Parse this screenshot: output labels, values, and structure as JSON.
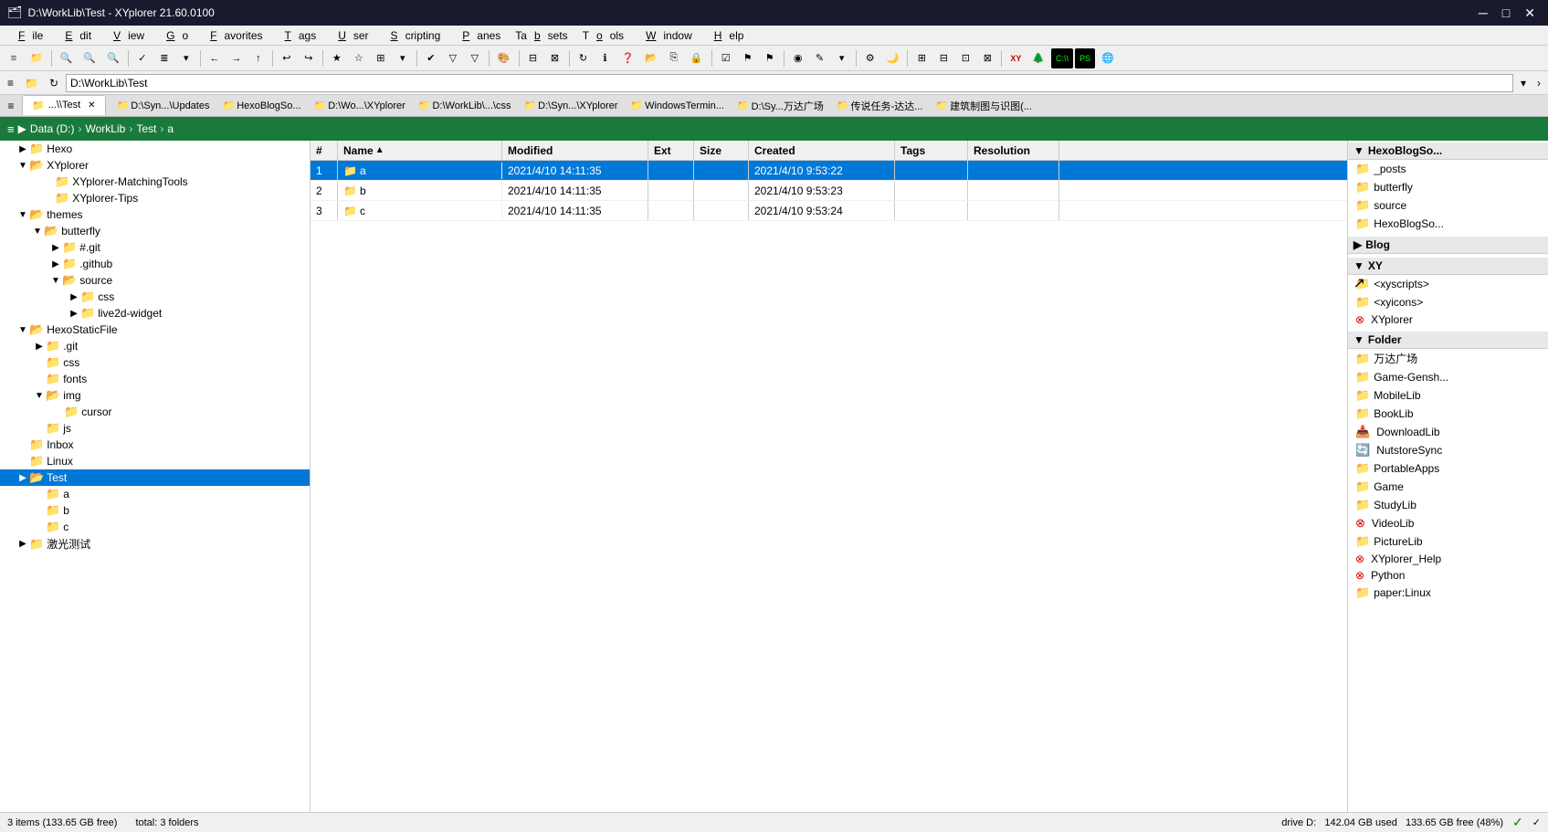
{
  "titlebar": {
    "title": "D:\\WorkLib\\Test - XYplorer 21.60.0100",
    "icon": "xy-icon"
  },
  "menubar": {
    "items": [
      "File",
      "Edit",
      "View",
      "Go",
      "Favorites",
      "Tags",
      "User",
      "Scripting",
      "Panes",
      "Tabsets",
      "Tools",
      "Window",
      "Help"
    ]
  },
  "address": {
    "path": "D:\\WorkLib\\Test",
    "label": "D:\\WorkLib\\Test"
  },
  "tabs": [
    {
      "label": "...\\Test",
      "icon": "📁",
      "active": true,
      "closable": true
    }
  ],
  "bookmarks": [
    "D:\\Syn...\\Updates",
    "HexoBlogSo...",
    "D:\\Wo...\\XYplorer",
    "D:\\WorkLib\\...\\css",
    "D:\\Syn...\\XYplorer",
    "WindowsTermin...",
    "D:\\Sy...万达广场",
    "传说任务-达达...",
    "建筑制图与识图(..."
  ],
  "breadcrumb": {
    "parts": [
      "Data (D:)",
      "WorkLib",
      "Test",
      "a"
    ]
  },
  "left_tree": [
    {
      "id": "hexo",
      "label": "Hexo",
      "level": 1,
      "expanded": false,
      "hasChildren": true
    },
    {
      "id": "xyplorer",
      "label": "XYplorer",
      "level": 1,
      "expanded": true,
      "hasChildren": true
    },
    {
      "id": "xyplorer-matching",
      "label": "XYplorer-MatchingTools",
      "level": 2,
      "expanded": false,
      "hasChildren": false
    },
    {
      "id": "xyplorer-tips",
      "label": "XYplorer-Tips",
      "level": 2,
      "expanded": false,
      "hasChildren": false
    },
    {
      "id": "themes",
      "label": "themes",
      "level": 1,
      "expanded": true,
      "hasChildren": true
    },
    {
      "id": "butterfly",
      "label": "butterfly",
      "level": 2,
      "expanded": true,
      "hasChildren": true
    },
    {
      "id": "dotgit",
      "label": "#.git",
      "level": 3,
      "expanded": false,
      "hasChildren": true
    },
    {
      "id": "dotgithub",
      "label": ".github",
      "level": 3,
      "expanded": false,
      "hasChildren": true
    },
    {
      "id": "source",
      "label": "source",
      "level": 3,
      "expanded": true,
      "hasChildren": true
    },
    {
      "id": "css",
      "label": "css",
      "level": 4,
      "expanded": false,
      "hasChildren": false
    },
    {
      "id": "live2d-widget",
      "label": "live2d-widget",
      "level": 4,
      "expanded": false,
      "hasChildren": false
    },
    {
      "id": "hexostaticfile",
      "label": "HexoStaticFile",
      "level": 1,
      "expanded": true,
      "hasChildren": true
    },
    {
      "id": "dot-git",
      "label": ".git",
      "level": 2,
      "expanded": false,
      "hasChildren": true
    },
    {
      "id": "css2",
      "label": "css",
      "level": 2,
      "expanded": false,
      "hasChildren": false
    },
    {
      "id": "fonts",
      "label": "fonts",
      "level": 2,
      "expanded": false,
      "hasChildren": false
    },
    {
      "id": "img",
      "label": "img",
      "level": 2,
      "expanded": true,
      "hasChildren": true
    },
    {
      "id": "cursor",
      "label": "cursor",
      "level": 3,
      "expanded": false,
      "hasChildren": false
    },
    {
      "id": "js",
      "label": "js",
      "level": 2,
      "expanded": false,
      "hasChildren": false
    },
    {
      "id": "inbox",
      "label": "Inbox",
      "level": 1,
      "expanded": false,
      "hasChildren": false
    },
    {
      "id": "linux",
      "label": "Linux",
      "level": 1,
      "expanded": false,
      "hasChildren": false
    },
    {
      "id": "test",
      "label": "Test",
      "level": 1,
      "expanded": true,
      "hasChildren": true,
      "selected": true
    },
    {
      "id": "test-a",
      "label": "a",
      "level": 2,
      "expanded": false,
      "hasChildren": false
    },
    {
      "id": "test-b",
      "label": "b",
      "level": 2,
      "expanded": false,
      "hasChildren": false
    },
    {
      "id": "test-c",
      "label": "c",
      "level": 2,
      "expanded": false,
      "hasChildren": false
    }
  ],
  "file_header": {
    "num": "#",
    "name": "Name",
    "sort_arrow": "▲",
    "modified": "Modified",
    "ext": "Ext",
    "size": "Size",
    "created": "Created",
    "tags": "Tags",
    "resolution": "Resolution"
  },
  "files": [
    {
      "num": "1",
      "name": "a",
      "type": "folder",
      "modified": "2021/4/10 14:11:35",
      "ext": "",
      "size": "",
      "created": "2021/4/10 9:53:22",
      "tags": "",
      "resolution": ""
    },
    {
      "num": "2",
      "name": "b",
      "type": "folder",
      "modified": "2021/4/10 14:11:35",
      "ext": "",
      "size": "",
      "created": "2021/4/10 9:53:23",
      "tags": "",
      "resolution": ""
    },
    {
      "num": "3",
      "name": "c",
      "type": "folder",
      "modified": "2021/4/10 14:11:35",
      "ext": "",
      "size": "",
      "created": "2021/4/10 9:53:24",
      "tags": "",
      "resolution": ""
    }
  ],
  "right_panel": {
    "sections": [
      {
        "id": "hexoblogso",
        "label": "HexoBlogSo...",
        "collapsed": false,
        "items": [
          {
            "label": "_posts",
            "icon": "folder"
          },
          {
            "label": "butterfly",
            "icon": "folder"
          },
          {
            "label": "source",
            "icon": "folder"
          },
          {
            "label": "HexoBlogSo...",
            "icon": "folder"
          }
        ]
      },
      {
        "id": "blog",
        "label": "Blog",
        "collapsed": true,
        "items": []
      },
      {
        "id": "xy",
        "label": "XY",
        "collapsed": false,
        "items": [
          {
            "label": "<xyscripts>",
            "icon": "folder"
          },
          {
            "label": "<xyicons>",
            "icon": "folder"
          },
          {
            "label": "XYplorer",
            "icon": "xy-special"
          }
        ]
      },
      {
        "id": "folder",
        "label": "Folder",
        "collapsed": false,
        "items": [
          {
            "label": "万达广场",
            "icon": "folder"
          },
          {
            "label": "Game-Gensh...",
            "icon": "folder"
          },
          {
            "label": "MobileLib",
            "icon": "folder"
          },
          {
            "label": "BookLib",
            "icon": "folder"
          },
          {
            "label": "DownloadLib",
            "icon": "download-folder"
          },
          {
            "label": "NutstoreSync",
            "icon": "sync-folder"
          },
          {
            "label": "PortableApps",
            "icon": "folder"
          },
          {
            "label": "Game",
            "icon": "folder"
          },
          {
            "label": "StudyLib",
            "icon": "folder"
          },
          {
            "label": "VideoLib",
            "icon": "video-folder"
          },
          {
            "label": "PictureLib",
            "icon": "folder"
          },
          {
            "label": "XYplorer_Help",
            "icon": "xy-special"
          },
          {
            "label": "Python",
            "icon": "xy-special"
          },
          {
            "label": "paper:Linux",
            "icon": "folder"
          }
        ]
      }
    ]
  },
  "statusbar": {
    "items_count": "3 items (133.65 GB free)",
    "total": "total: 3 folders",
    "drive": "drive D:",
    "used": "142.04 GB used",
    "free": "133.65 GB free (48%)"
  }
}
